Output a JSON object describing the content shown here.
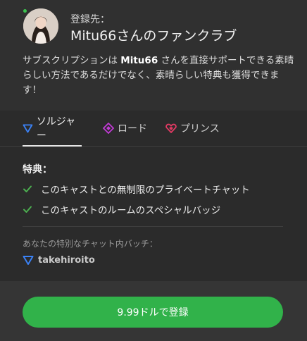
{
  "header": {
    "dest_label": "登録先：",
    "club_name": "Mitu66さんのファンクラブ",
    "desc_prefix": "サブスクリプションは ",
    "desc_user": "Mitu66",
    "desc_suffix": " さんを直接サポートできる素晴らしい方法であるだけでなく、素晴らしい特典も獲得できます！"
  },
  "tabs": [
    {
      "label": "ソルジャー",
      "icon": "triangle-down-icon",
      "color": "#3b82f6",
      "active": true
    },
    {
      "label": "ロード",
      "icon": "diamond-icon",
      "color": "#c23bd6",
      "active": false
    },
    {
      "label": "プリンス",
      "icon": "heart-gem-icon",
      "color": "#e23a63",
      "active": false
    }
  ],
  "perks": {
    "title": "特典：",
    "items": [
      "このキャストとの無制限のプライベートチャット",
      "このキャストのルームのスペシャルバッジ"
    ],
    "check_color": "#4caf50"
  },
  "badge": {
    "label": "あなたの特別なチャット内バッチ：",
    "username": "takehiroito"
  },
  "cta": {
    "label": "9.99ドルで登録",
    "color": "#31b24a"
  }
}
